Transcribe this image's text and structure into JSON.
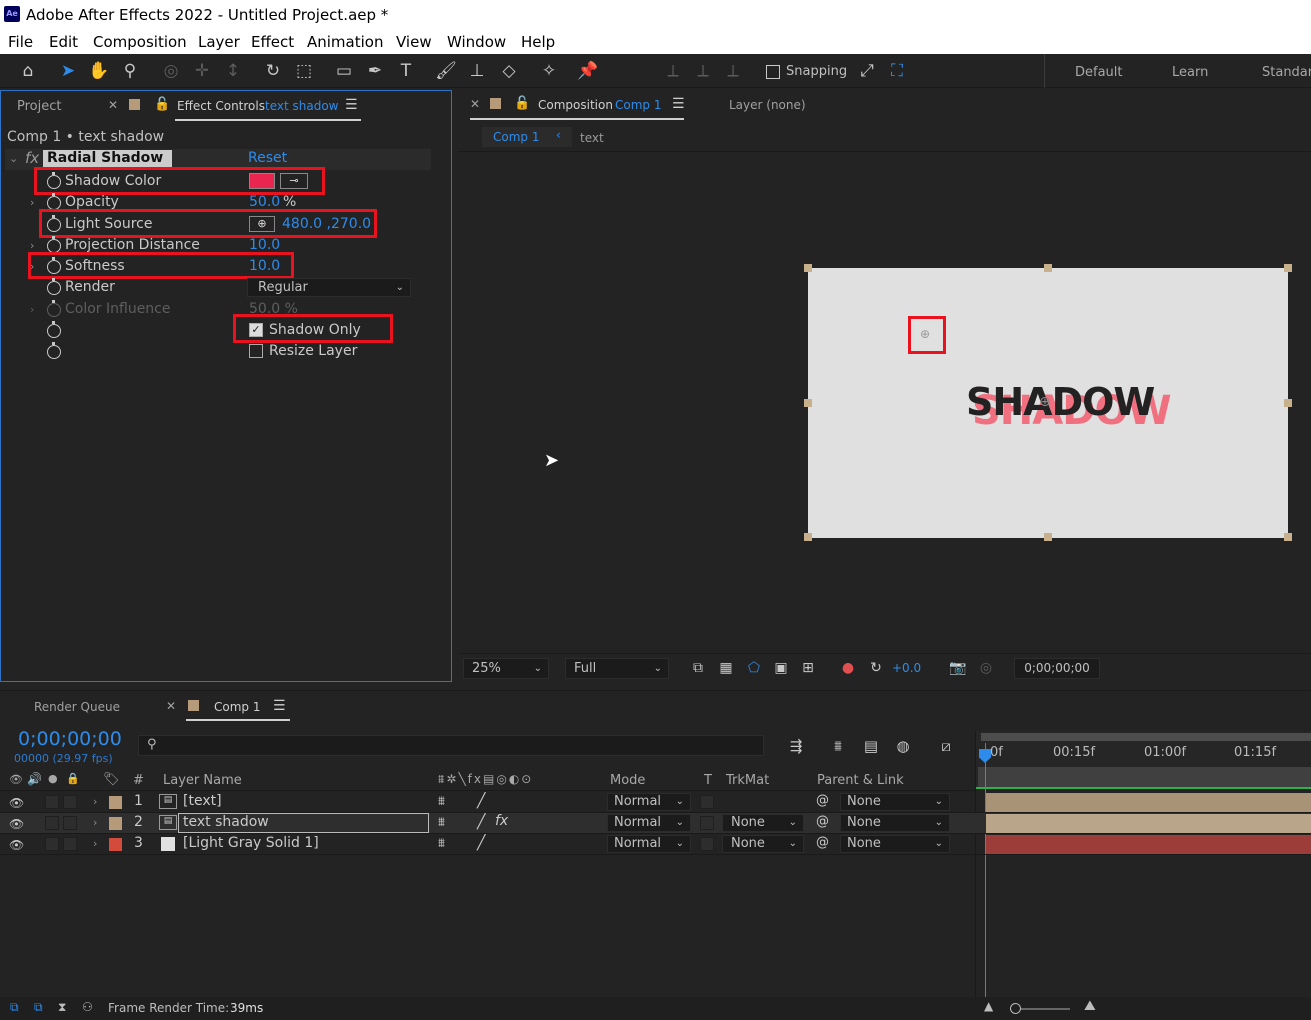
{
  "window": {
    "title": "Adobe After Effects 2022 - Untitled Project.aep *",
    "app_badge": "Ae"
  },
  "menu": [
    "File",
    "Edit",
    "Composition",
    "Layer",
    "Effect",
    "Animation",
    "View",
    "Window",
    "Help"
  ],
  "toolbar": {
    "snapping_label": "Snapping",
    "workspaces": [
      "Default",
      "Learn",
      "Standard"
    ]
  },
  "left_panel": {
    "tab_project": "Project",
    "tab_effect_controls": "Effect Controls",
    "tab_effect_target": "text shadow",
    "header": "Comp 1 • text shadow",
    "effect_name": "Radial Shadow",
    "reset_label": "Reset",
    "properties": {
      "shadow_color": {
        "label": "Shadow Color",
        "color": "#e8264f"
      },
      "opacity": {
        "label": "Opacity",
        "value": "50.0",
        "unit": "%"
      },
      "light_source": {
        "label": "Light Source",
        "value": "480.0 ,270.0"
      },
      "projection_distance": {
        "label": "Projection Distance",
        "value": "10.0"
      },
      "softness": {
        "label": "Softness",
        "value": "10.0"
      },
      "render": {
        "label": "Render",
        "value": "Regular"
      },
      "color_influence": {
        "label": "Color Influence",
        "value": "50.0 %"
      },
      "shadow_only": {
        "label": "Shadow Only",
        "checked": true
      },
      "resize_layer": {
        "label": "Resize Layer",
        "checked": false
      }
    }
  },
  "comp_panel": {
    "tab_label": "Composition",
    "tab_comp": "Comp 1",
    "tab_layer": "Layer (none)",
    "breadcrumb_comp": "Comp 1",
    "breadcrumb_layer": "text",
    "canvas_text": "SHADOW",
    "shadow_text": "SHADOW",
    "zoom": "25%",
    "resolution": "Full",
    "exposure": "+0.0",
    "timecode": "0;00;00;00"
  },
  "timeline": {
    "tab_render_queue": "Render Queue",
    "tab_comp": "Comp 1",
    "timecode": "0;00;00;00",
    "fps": "00000 (29.97 fps)",
    "columns": {
      "layer_name": "Layer Name",
      "mode": "Mode",
      "t": "T",
      "trkmat": "TrkMat",
      "parent": "Parent & Link"
    },
    "ruler": [
      "0f",
      "00:15f",
      "01:00f",
      "01:15f"
    ],
    "layers": [
      {
        "num": "1",
        "name": "[text]",
        "mode": "Normal",
        "trkmat": "",
        "parent": "None",
        "label_color": "#b59b7a"
      },
      {
        "num": "2",
        "name": "text shadow",
        "mode": "Normal",
        "trkmat": "None",
        "parent": "None",
        "label_color": "#b59b7a"
      },
      {
        "num": "3",
        "name": "[Light Gray Solid 1]",
        "mode": "Normal",
        "trkmat": "None",
        "parent": "None",
        "label_color": "#d44b3c"
      }
    ]
  },
  "status": {
    "label": "Frame Render Time:",
    "value": "39ms"
  }
}
